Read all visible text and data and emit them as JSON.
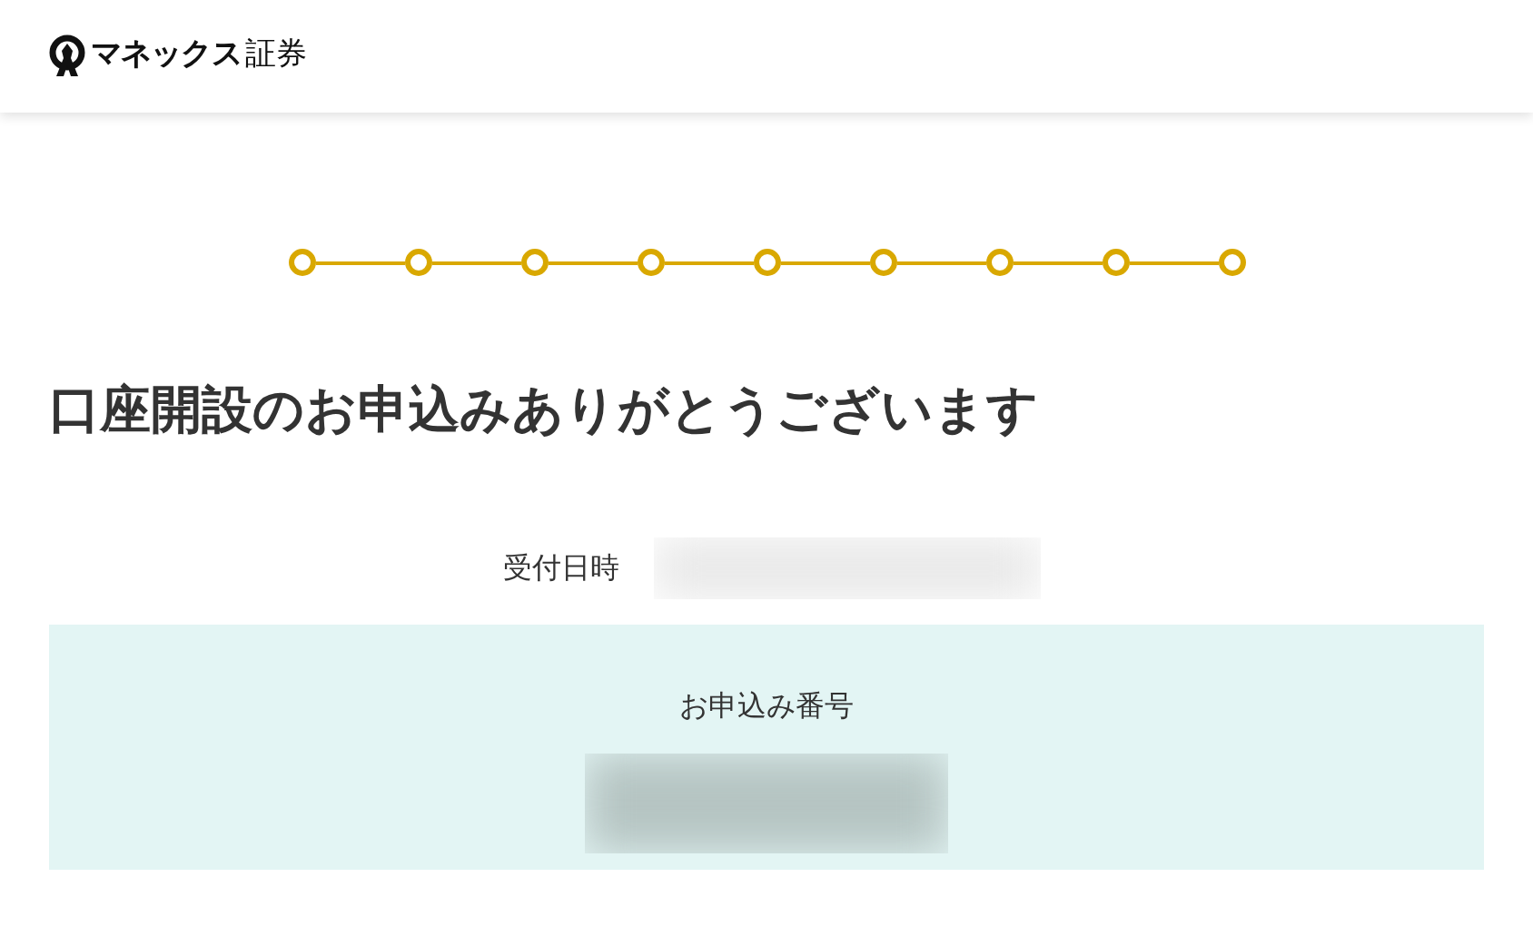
{
  "header": {
    "logo_bold": "マネックス",
    "logo_regular": "証券"
  },
  "steps": [
    {
      "done": true
    },
    {
      "done": true
    },
    {
      "done": true
    },
    {
      "done": true
    },
    {
      "done": true
    },
    {
      "done": true
    },
    {
      "done": true
    },
    {
      "done": true
    },
    {
      "done": true
    }
  ],
  "heading": "口座開設のお申込みありがとうございます",
  "receipt": {
    "label": "受付日時",
    "value_redacted": true
  },
  "application": {
    "label": "お申込み番号",
    "value_redacted": true
  }
}
